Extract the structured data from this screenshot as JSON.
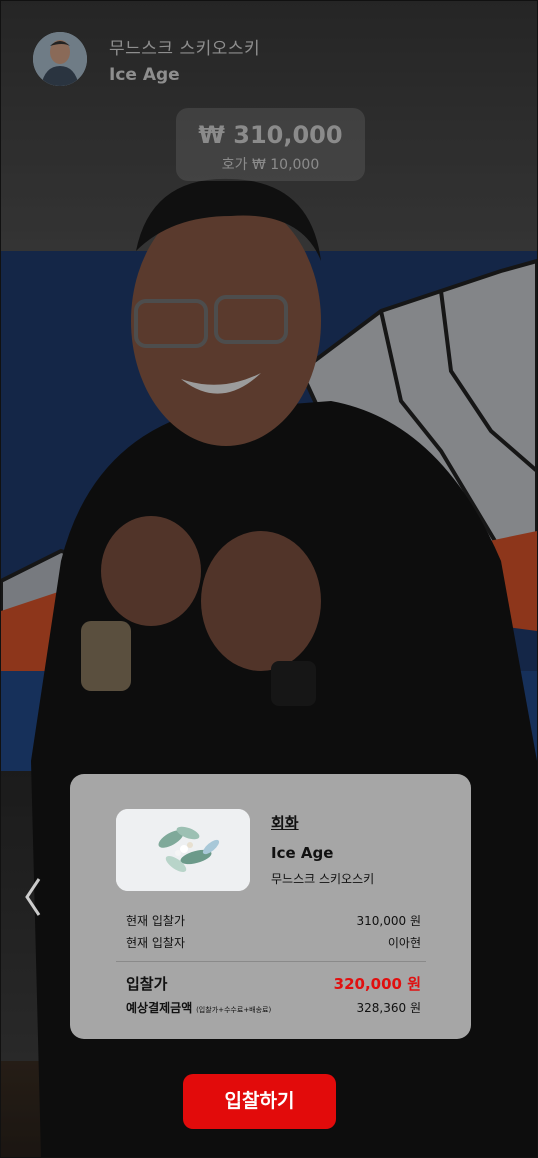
{
  "header": {
    "artist": "무느스크 스키오스키",
    "artwork_title": "Ice Age"
  },
  "price_box": {
    "current_price": "₩ 310,000",
    "increment": "호가 ₩ 10,000"
  },
  "card": {
    "category": "회화",
    "title": "Ice Age",
    "artist": "무느스크 스키오스키",
    "current_bid_label": "현재 입찰가",
    "current_bid_value": "310,000 원",
    "current_bidder_label": "현재 입찰자",
    "current_bidder_value": "이아현",
    "bid_price_label": "입찰가",
    "bid_price_value": "320,000 원",
    "estimate_label": "예상결제금액",
    "estimate_note": "(입찰가+수수료+배송료)",
    "estimate_value": "328,360 원"
  },
  "actions": {
    "bid_button": "입찰하기"
  },
  "colors": {
    "accent": "#e20b0b",
    "bid_price": "#e01010"
  },
  "icons": {
    "back": "chevron-left-icon"
  }
}
